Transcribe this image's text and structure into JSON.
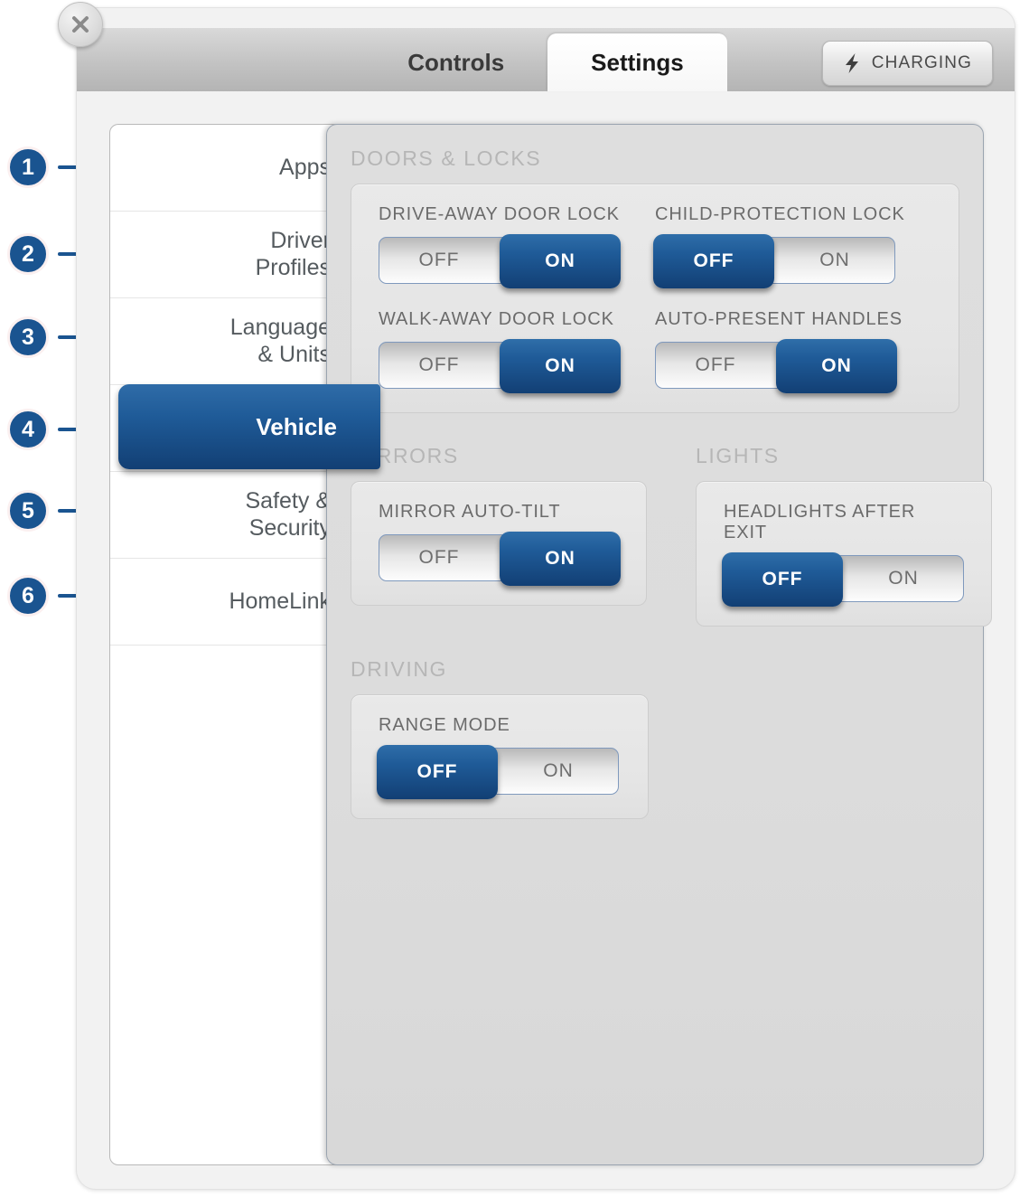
{
  "window": {
    "close_icon": "close-icon"
  },
  "tabs": [
    {
      "label": "Controls",
      "active": false
    },
    {
      "label": "Settings",
      "active": true
    }
  ],
  "status_button": {
    "label": "CHARGING",
    "icon": "lightning-bolt-icon"
  },
  "sidebar": {
    "items": [
      {
        "label": "Apps",
        "selected": false,
        "callout": "1"
      },
      {
        "label": "Driver Profiles",
        "line1": "Driver",
        "line2": "Profiles",
        "selected": false,
        "callout": "2"
      },
      {
        "label": "Language & Units",
        "line1": "Language",
        "line2": "& Units",
        "selected": false,
        "callout": "3"
      },
      {
        "label": "Vehicle",
        "selected": true,
        "callout": "4"
      },
      {
        "label": "Safety & Security",
        "line1": "Safety &",
        "line2": "Security",
        "selected": false,
        "callout": "5"
      },
      {
        "label": "HomeLink",
        "selected": false,
        "callout": "6"
      }
    ]
  },
  "callouts": [
    "1",
    "2",
    "3",
    "4",
    "5",
    "6"
  ],
  "sections": {
    "doors_locks": {
      "title": "DOORS & LOCKS",
      "controls": [
        {
          "label": "DRIVE-AWAY DOOR LOCK",
          "off": "OFF",
          "on": "ON",
          "value": "ON"
        },
        {
          "label": "CHILD-PROTECTION LOCK",
          "off": "OFF",
          "on": "ON",
          "value": "OFF"
        },
        {
          "label": "WALK-AWAY DOOR LOCK",
          "off": "OFF",
          "on": "ON",
          "value": "ON"
        },
        {
          "label": "AUTO-PRESENT HANDLES",
          "off": "OFF",
          "on": "ON",
          "value": "ON"
        }
      ]
    },
    "mirrors": {
      "title": "MIRRORS",
      "controls": [
        {
          "label": "MIRROR AUTO-TILT",
          "off": "OFF",
          "on": "ON",
          "value": "ON"
        }
      ]
    },
    "lights": {
      "title": "LIGHTS",
      "controls": [
        {
          "label": "HEADLIGHTS AFTER EXIT",
          "off": "OFF",
          "on": "ON",
          "value": "OFF"
        }
      ]
    },
    "driving": {
      "title": "DRIVING",
      "controls": [
        {
          "label": "RANGE MODE",
          "off": "OFF",
          "on": "ON",
          "value": "OFF"
        }
      ]
    }
  },
  "colors": {
    "accent_blue": "#1a5490",
    "knob_blue_top": "#2f6ea9",
    "knob_blue_bottom": "#123f74",
    "panel_gray": "#dcdcdc",
    "card_gray": "#e7e7e7",
    "section_title_gray": "#b6b6b6"
  }
}
